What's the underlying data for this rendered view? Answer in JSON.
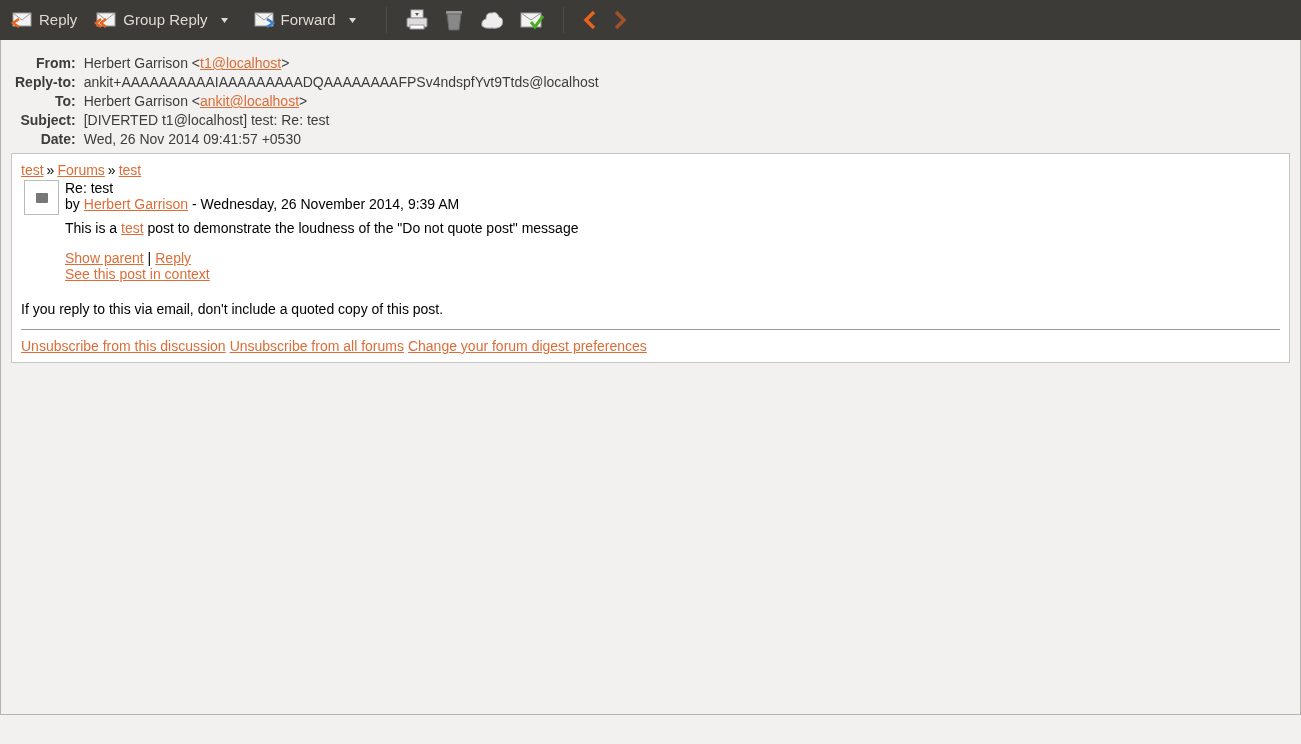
{
  "toolbar": [
    {
      "kind": "labeled",
      "label": "Reply",
      "dropdown": false
    },
    {
      "kind": "labeled",
      "label": "Group Reply",
      "dropdown": true
    },
    {
      "kind": "labeled",
      "label": "Forward",
      "dropdown": true
    },
    {
      "kind": "separator"
    },
    {
      "kind": "icon"
    },
    {
      "kind": "icon"
    },
    {
      "kind": "icon"
    },
    {
      "kind": "icon"
    },
    {
      "kind": "separator"
    },
    {
      "kind": "icon"
    },
    {
      "kind": "icon"
    }
  ],
  "headers": [
    {
      "label": "From:",
      "value": [
        {
          "kind": "text",
          "text": "Herbert Garrison <"
        },
        {
          "kind": "link",
          "text": "t1@localhost"
        },
        {
          "kind": "text",
          "text": ">"
        }
      ]
    },
    {
      "label": "Reply-to:",
      "value": [
        {
          "kind": "text",
          "text": "ankit+AAAAAAAAAAIAAAAAAAAADQAAAAAAAAFPSv4ndspfYvt9Ttds@localhost"
        }
      ]
    },
    {
      "label": "To:",
      "value": [
        {
          "kind": "text",
          "text": "Herbert Garrison <"
        },
        {
          "kind": "link",
          "text": "ankit@localhost"
        },
        {
          "kind": "text",
          "text": ">"
        }
      ]
    },
    {
      "label": "Subject:",
      "value": [
        {
          "kind": "text",
          "text": "[DIVERTED t1@localhost] test: Re: test"
        }
      ]
    },
    {
      "label": "Date:",
      "value": [
        {
          "kind": "text",
          "text": "Wed, 26 Nov 2014 09:41:57 +0530"
        }
      ]
    }
  ],
  "body": {
    "breadcrumb": [
      {
        "kind": "link",
        "text": "test"
      },
      {
        "kind": "text",
        "text": "»"
      },
      {
        "kind": "link",
        "text": "Forums"
      },
      {
        "kind": "text",
        "text": "»"
      },
      {
        "kind": "link",
        "text": "test"
      }
    ],
    "post": {
      "subject": "Re: test",
      "by": "by",
      "author": "Herbert Garrison",
      "date": "- Wednesday, 26 November 2014, 9:39 AM",
      "message": [
        {
          "kind": "text",
          "text": "This is a "
        },
        {
          "kind": "link",
          "text": "test"
        },
        {
          "kind": "text",
          "text": " post to demonstrate the loudness of the \"Do not quote post\" message"
        }
      ],
      "commands": [
        {
          "kind": "link",
          "text": "Show parent"
        },
        {
          "kind": "text",
          "text": "|"
        },
        {
          "kind": "link",
          "text": "Reply"
        }
      ],
      "context_link": "See this post in context"
    },
    "notice": "If you reply to this via email, don't include a quoted copy of this post.",
    "footer_links": [
      "Unsubscribe from this discussion",
      "Unsubscribe from all forums",
      "Change your forum digest preferences"
    ]
  }
}
